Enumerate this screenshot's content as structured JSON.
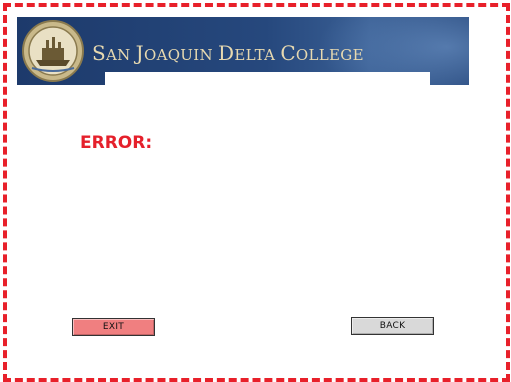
{
  "header": {
    "college_name_first": "S",
    "college_name_rest_1": "AN ",
    "college_name_j": "J",
    "college_name_rest_2": "OAQUIN ",
    "college_name_d": "D",
    "college_name_rest_3": "ELTA ",
    "college_name_c": "C",
    "college_name_rest_4": "OLLEGE",
    "logo_icon": "college-seal-icon"
  },
  "main": {
    "error_title": "ERROR:"
  },
  "actions": {
    "exit_label": "EXIT",
    "back_label": "BACK"
  },
  "colors": {
    "frame_border": "#e8202a",
    "banner": "#1d3a6b",
    "error_text": "#e5202b",
    "exit_button": "#f07f80",
    "back_button": "#d9d9d9"
  }
}
